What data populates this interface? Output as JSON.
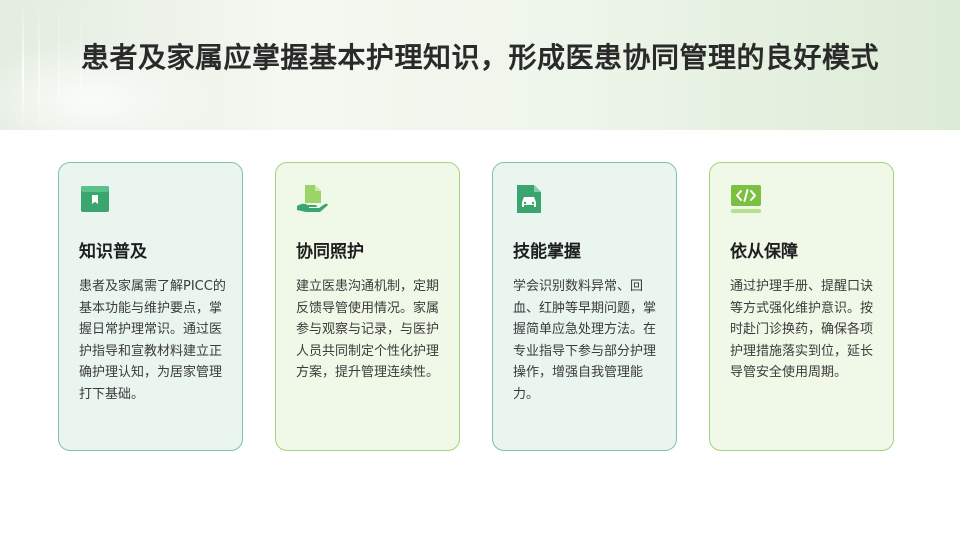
{
  "page": {
    "title": "患者及家属应掌握基本护理知识，形成医患协同管理的良好模式"
  },
  "colors": {
    "teal_accent": "#3aa56f",
    "lime_accent": "#7cc043",
    "title_text": "#2a2a2a"
  },
  "cards": [
    {
      "icon": "book-icon",
      "title": "知识普及",
      "body": "患者及家属需了解PICC的基本功能与维护要点，掌握日常护理常识。通过医护指导和宣教材料建立正确护理认知，为居家管理打下基础。"
    },
    {
      "icon": "hand-document-icon",
      "title": "协同照护",
      "body": "建立医患沟通机制，定期反馈导管使用情况。家属参与观察与记录，与医护人员共同制定个性化护理方案，提升管理连续性。"
    },
    {
      "icon": "car-document-icon",
      "title": "技能掌握",
      "body": "学会识别数料异常、回血、红肿等早期问题，掌握简单应急处理方法。在专业指导下参与部分护理操作，增强自我管理能力。"
    },
    {
      "icon": "code-icon",
      "title": "依从保障",
      "body": "通过护理手册、提醒口诀等方式强化维护意识。按时赴门诊换药，确保各项护理措施落实到位，延长导管安全使用周期。"
    }
  ]
}
